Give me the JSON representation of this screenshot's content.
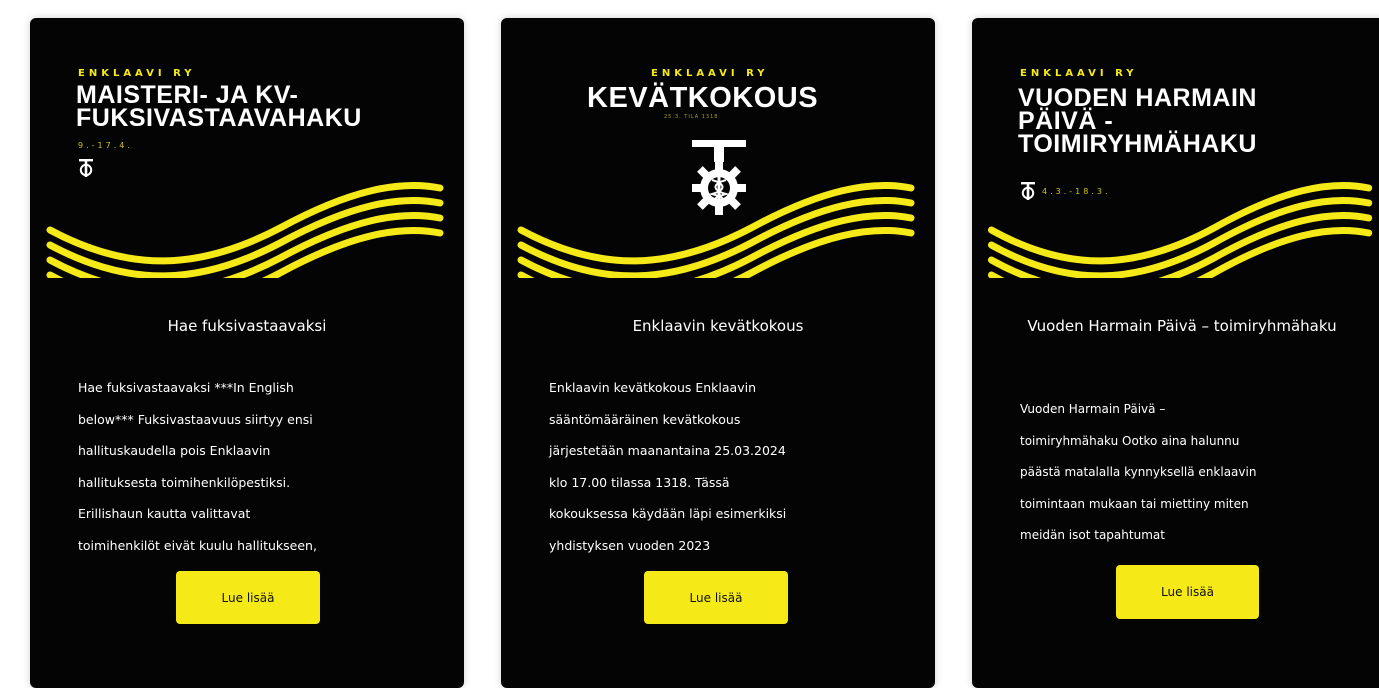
{
  "colors": {
    "card_bg": "#040404",
    "accent": "#f5ea18",
    "text": "#ffffff"
  },
  "cards": [
    {
      "banner": {
        "org": "ENKLAAVI RY",
        "heading": "MAISTERI- JA KV-\nFUKSIVASTAAVAHAKU",
        "dates": "9.-17.4.",
        "logo_icon": "teekkari-emblem-icon"
      },
      "title": "Hae fuksivastaavaksi",
      "excerpt": "Hae fuksivastaavaksi ***In English\nbelow*** Fuksivastaavuus siirtyy ensi\nhallituskaudella pois Enklaavin\nhallituksesta toimihenkilöpestiksi.\nErillishaun kautta valittavat\ntoimihenkilöt eivät kuulu hallitukseen,",
      "button": "Lue lisää"
    },
    {
      "banner": {
        "org": "ENKLAAVI RY",
        "heading": "KEVÄTKOKOUS",
        "subdate": "25.3. TILA 1318",
        "logo_icon": "gear-caduceus-emblem-icon"
      },
      "title": "Enklaavin kevätkokous",
      "excerpt": "Enklaavin kevätkokous Enklaavin\nsääntömääräinen kevätkokous\njärjestetään maanantaina 25.03.2024\nklo 17.00 tilassa 1318. Tässä\nkokouksessa käydään läpi esimerkiksi\nyhdistyksen vuoden 2023",
      "button": "Lue lisää"
    },
    {
      "banner": {
        "org": "ENKLAAVI RY",
        "heading": "VUODEN HARMAIN\nPÄIVÄ -\nTOIMIRYHMÄHAKU",
        "dates": "4.3.-18.3.",
        "logo_icon": "teekkari-emblem-icon"
      },
      "title": "Vuoden Harmain Päivä –\ntoimiryhmähaku",
      "excerpt": "Vuoden Harmain Päivä –\ntoimiryhmähaku Ootko aina halunnu\npäästä matalalla kynnyksellä enklaavin\ntoimintaan mukaan tai miettiny miten\nmeidän isot tapahtumat",
      "button": "Lue lisää"
    }
  ]
}
